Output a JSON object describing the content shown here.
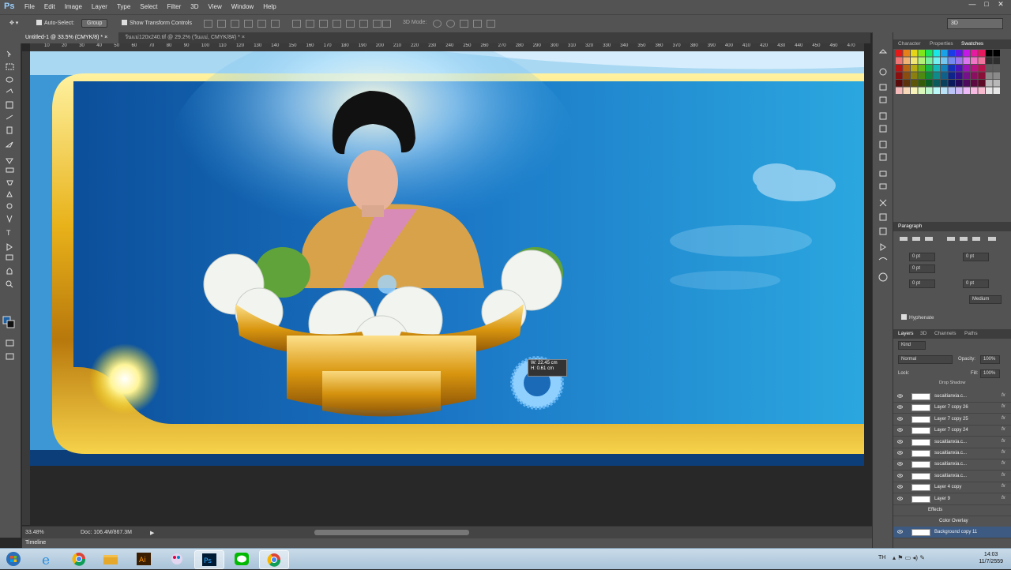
{
  "app": {
    "logo": "Ps"
  },
  "menu": [
    "File",
    "Edit",
    "Image",
    "Layer",
    "Type",
    "Select",
    "Filter",
    "3D",
    "View",
    "Window",
    "Help"
  ],
  "window_controls": {
    "minimize": "—",
    "maximize": "□",
    "close": "✕"
  },
  "options_bar": {
    "auto_select_label": "Auto-Select:",
    "auto_select_value": "Group",
    "show_transform_label": "Show Transform Controls",
    "mode_3d_label": "3D Mode:",
    "workspace": "3D"
  },
  "tabs": [
    {
      "label": "Untitled-1 @ 33.5% (CMYK/8) *",
      "close": "×"
    },
    {
      "label": "วันแม่120x240.tif @ 29.2% (วันแม่, CMYK/8#) *",
      "close": "×"
    }
  ],
  "ruler_ticks": [
    "10",
    "20",
    "30",
    "40",
    "50",
    "60",
    "70",
    "80",
    "90",
    "100",
    "110",
    "120",
    "130",
    "140",
    "150",
    "160",
    "170",
    "180",
    "190",
    "200",
    "210",
    "220",
    "230",
    "240",
    "250",
    "260",
    "270",
    "280",
    "290",
    "300",
    "310",
    "320",
    "330",
    "340",
    "350",
    "360",
    "370",
    "380",
    "390",
    "400",
    "410",
    "420",
    "430",
    "440",
    "450",
    "460",
    "470"
  ],
  "transform_readout": {
    "w": "W: 22.45 cm",
    "h": "H: 0.61 cm"
  },
  "status": {
    "zoom": "33.48%",
    "doc": "Doc: 106.4M/867.3M"
  },
  "timeline_label": "Timeline",
  "panels": {
    "top_tabs": [
      "Character",
      "Properties",
      "Swatches"
    ],
    "active_top_tab": "Swatches",
    "paragraph_title": "Paragraph",
    "paragraph_fields": [
      "0 pt",
      "0 pt",
      "0 pt",
      "0 pt",
      "0 pt"
    ],
    "composer": "Medium",
    "hyphenate": "Hyphenate",
    "layers_tabs": [
      "Layers",
      "3D",
      "Channels",
      "Paths"
    ],
    "kind_label": "Kind",
    "blend_mode": "Normal",
    "opacity_label": "Opacity:",
    "opacity_value": "100%",
    "lock_label": "Lock:",
    "fill_label": "Fill:",
    "fill_value": "100%",
    "top_effect": "Drop Shadow",
    "layers": [
      {
        "name": "sucaitianxia.c...",
        "fx": "fx"
      },
      {
        "name": "Layer 7 copy 26",
        "fx": "fx"
      },
      {
        "name": "Layer 7 copy 25",
        "fx": "fx"
      },
      {
        "name": "Layer 7 copy 24",
        "fx": "fx"
      },
      {
        "name": "sucaitianxia.c...",
        "fx": "fx"
      },
      {
        "name": "sucaitianxia.c...",
        "fx": "fx"
      },
      {
        "name": "sucaitianxia.c...",
        "fx": "fx"
      },
      {
        "name": "sucaitianxia.c...",
        "fx": "fx"
      },
      {
        "name": "Layer 4 copy",
        "fx": "fx"
      },
      {
        "name": "Layer 9",
        "fx": "fx"
      }
    ],
    "effects_label": "Effects",
    "color_overlay": "Color Overlay",
    "last_layer": "Background copy 11"
  },
  "taskbar": {
    "apps": [
      "start",
      "ie",
      "chrome",
      "explorer",
      "illustrator",
      "paint",
      "photoshop",
      "line",
      "chrome2"
    ],
    "lang": "TH",
    "time": "14:03",
    "date": "11/7/2559"
  },
  "colors": {
    "gold": "#e8b21a",
    "canvas_blue": "#1f7fc8",
    "ui_gray": "#535353"
  }
}
